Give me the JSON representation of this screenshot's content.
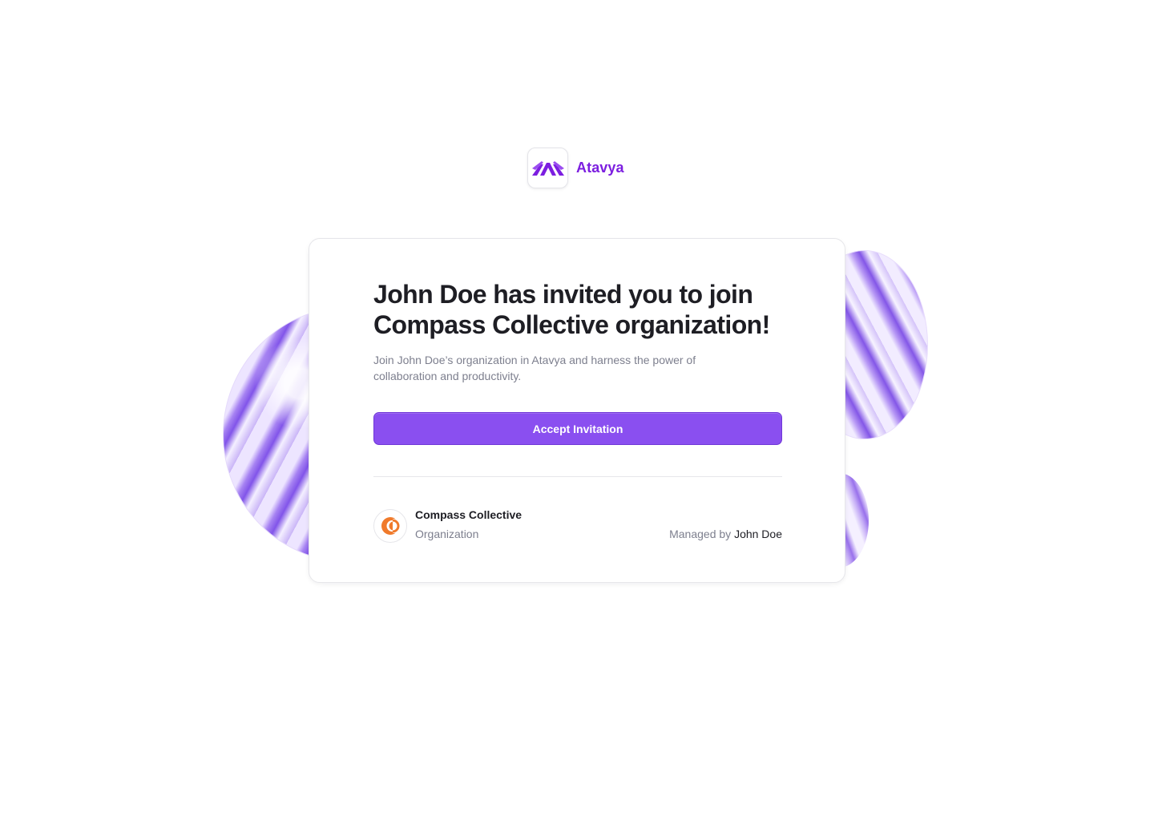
{
  "brand": {
    "name": "Atavya",
    "logo_icon": "atavya-logo-icon",
    "color": "#7c1ee0"
  },
  "invite": {
    "headline_line1": "John Doe has invited you to join",
    "headline_line2": "Compass Collective organization!",
    "subtext": "Join John Doe’s organization in Atavya and harness the power of collaboration and productivity.",
    "accept_label": "Accept Invitation",
    "accent_color": "#8a4ff0"
  },
  "organization": {
    "name": "Compass Collective",
    "type": "Organization",
    "managed_by_prefix": "Managed by",
    "manager_name": "John Doe",
    "logo_icon": "compass-collective-logo-icon",
    "logo_color": "#f07a2b"
  }
}
